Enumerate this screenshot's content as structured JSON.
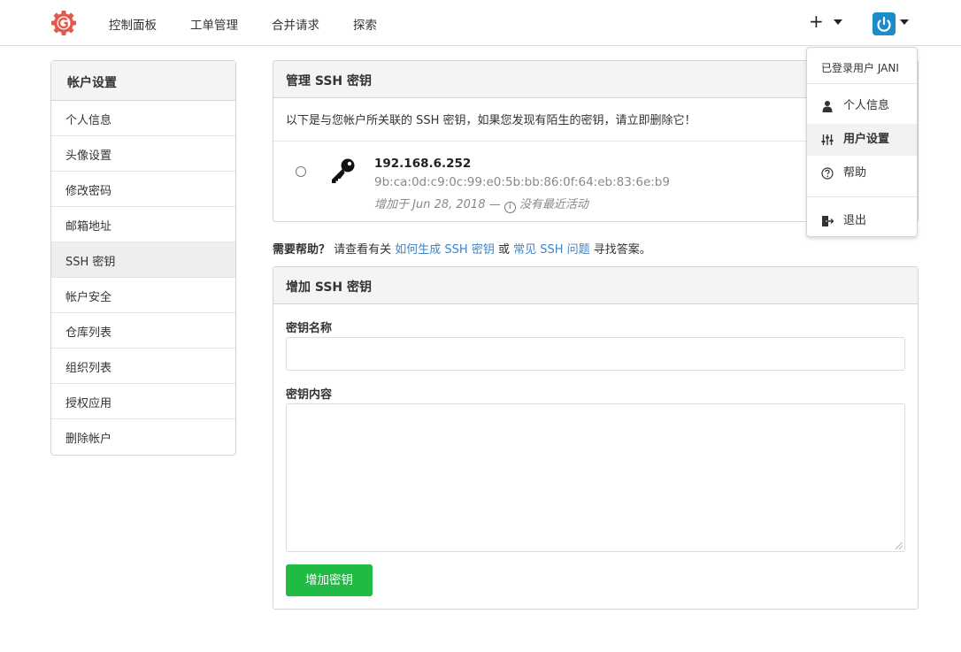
{
  "nav": {
    "items": [
      "控制面板",
      "工单管理",
      "合并请求",
      "探索"
    ],
    "plus_label": "+"
  },
  "sidebar": {
    "title": "帐户设置",
    "items": [
      "个人信息",
      "头像设置",
      "修改密码",
      "邮箱地址",
      "SSH 密钥",
      "帐户安全",
      "仓库列表",
      "组织列表",
      "授权应用",
      "删除帐户"
    ],
    "active_index": 4
  },
  "manage_panel": {
    "title": "管理 SSH 密钥",
    "notice": "以下是与您帐户所关联的 SSH 密钥，如果您发现有陌生的密钥，请立即删除它！",
    "key": {
      "name": "192.168.6.252",
      "fingerprint": "9b:ca:0d:c9:0c:99:e0:5b:bb:86:0f:64:eb:83:6e:b9",
      "added_prefix": "增加于 Jun 28, 2018 —",
      "info_glyph": "i",
      "activity": "没有最近活动"
    }
  },
  "help": {
    "lead": "需要帮助？",
    "text1": " 请查看有关 ",
    "link1": "如何生成 SSH 密钥",
    "text2": " 或 ",
    "link2": "常见 SSH 问题",
    "text3": " 寻找答案。"
  },
  "add_panel": {
    "title": "增加 SSH 密钥",
    "name_label": "密钥名称",
    "name_value": "",
    "content_label": "密钥内容",
    "content_value": "",
    "submit_label": "增加密钥"
  },
  "user_menu": {
    "header": "已登录用户 JANI",
    "items": [
      "个人信息",
      "用户设置",
      "帮助",
      "退出"
    ],
    "selected_index": 1
  },
  "colors": {
    "accent_green": "#21ba45",
    "link_blue": "#4183c4",
    "avatar_blue": "#1a8cc8",
    "logo_red": "#e05a4e"
  }
}
